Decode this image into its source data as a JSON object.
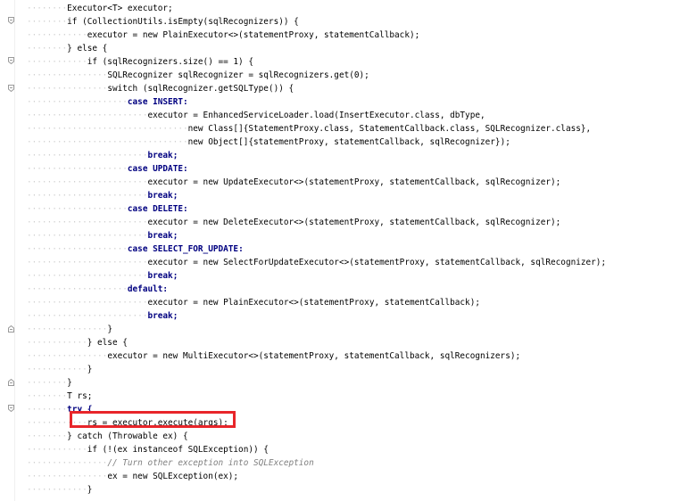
{
  "editor": {
    "lines": [
      {
        "id": "l1",
        "indent": "········",
        "text": "Executor<T> executor;"
      },
      {
        "id": "l2",
        "indent": "········",
        "text": "if (CollectionUtils.isEmpty(sqlRecognizers)) {"
      },
      {
        "id": "l3",
        "indent": "············",
        "text": "executor = new PlainExecutor<>(statementProxy, statementCallback);"
      },
      {
        "id": "l4",
        "indent": "········",
        "text": "} else {"
      },
      {
        "id": "l5",
        "indent": "············",
        "text": "if (sqlRecognizers.size() == 1) {"
      },
      {
        "id": "l6",
        "indent": "················",
        "text": "SQLRecognizer sqlRecognizer = sqlRecognizers.get(0);"
      },
      {
        "id": "l7",
        "indent": "················",
        "text": "switch (sqlRecognizer.getSQLType()) {"
      },
      {
        "id": "l8",
        "text": "case INSERT:"
      },
      {
        "id": "l9",
        "text": "executor = EnhancedServiceLoader.load(InsertExecutor.class, dbType,"
      },
      {
        "id": "l10",
        "text": "new Class[]{StatementProxy.class, StatementCallback.class, SQLRecognizer.class},"
      },
      {
        "id": "l11",
        "text": "new Object[]{statementProxy, statementCallback, sqlRecognizer});"
      },
      {
        "id": "l12",
        "text": "break;"
      },
      {
        "id": "l13",
        "text": "case UPDATE:"
      },
      {
        "id": "l14",
        "text": "executor = new UpdateExecutor<>(statementProxy, statementCallback, sqlRecognizer);"
      },
      {
        "id": "l15",
        "text": "break;"
      },
      {
        "id": "l16",
        "text": "case DELETE:"
      },
      {
        "id": "l17",
        "text": "executor = new DeleteExecutor<>(statementProxy, statementCallback, sqlRecognizer);"
      },
      {
        "id": "l18",
        "text": "break;"
      },
      {
        "id": "l19",
        "text": "case SELECT_FOR_UPDATE:"
      },
      {
        "id": "l20",
        "text": "executor = new SelectForUpdateExecutor<>(statementProxy, statementCallback, sqlRecognizer);"
      },
      {
        "id": "l21",
        "text": "break;"
      },
      {
        "id": "l22",
        "text": "default:"
      },
      {
        "id": "l23",
        "text": "executor = new PlainExecutor<>(statementProxy, statementCallback);"
      },
      {
        "id": "l24",
        "text": "break;"
      },
      {
        "id": "l25",
        "text": "}"
      },
      {
        "id": "l26",
        "text": "} else {"
      },
      {
        "id": "l27",
        "text": "executor = new MultiExecutor<>(statementProxy, statementCallback, sqlRecognizers);"
      },
      {
        "id": "l28",
        "text": "}"
      },
      {
        "id": "l29",
        "text": "}"
      },
      {
        "id": "l30",
        "text": "T rs;"
      },
      {
        "id": "l31",
        "text": "try {"
      },
      {
        "id": "l32",
        "text": "rs = executor.execute(args);"
      },
      {
        "id": "l33",
        "text": "} catch (Throwable ex) {"
      },
      {
        "id": "l34",
        "text": "if (!(ex instanceof SQLException)) {"
      },
      {
        "id": "l35",
        "text": "// Turn other exception into SQLException"
      },
      {
        "id": "l36",
        "text": "ex = new SQLException(ex);"
      },
      {
        "id": "l37",
        "text": "}"
      }
    ],
    "highlight_color": "#e8252a",
    "keyword_color": "#000080",
    "constant_color": "#660e7a",
    "comment_color": "#808080",
    "number_color": "#0000ff"
  }
}
